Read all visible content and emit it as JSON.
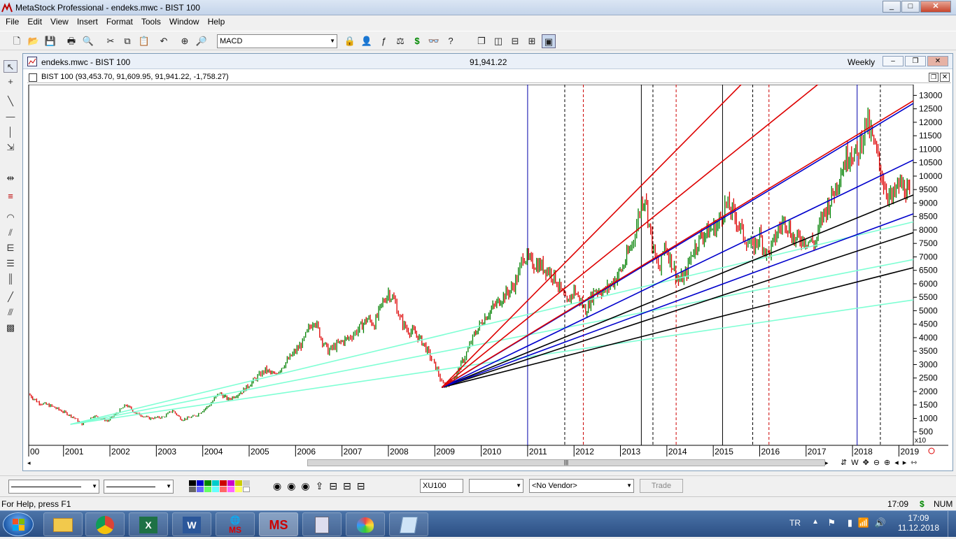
{
  "app": {
    "title": "MetaStock Professional - endeks.mwc - BIST 100",
    "window_buttons": [
      "_",
      "□",
      "✕"
    ]
  },
  "menu": [
    "File",
    "Edit",
    "View",
    "Insert",
    "Format",
    "Tools",
    "Window",
    "Help"
  ],
  "toolbar": {
    "indicator_select": "MACD",
    "icons": [
      "new-icon",
      "open-icon",
      "save-icon",
      "print-icon",
      "print-preview-icon",
      "cut-icon",
      "copy-icon",
      "paste-icon",
      "undo-icon",
      "crosshair-icon",
      "zoom-icon",
      "indicator-builder-icon",
      "expert-advisor-icon",
      "function-icon",
      "system-tester-icon",
      "dollar-icon",
      "explorer-icon",
      "help-icon",
      "cascade-icon",
      "tile-vertical-icon",
      "tile-horizontal-icon",
      "tile-icon",
      "active-icon"
    ]
  },
  "chart_window": {
    "title": "endeks.mwc - BIST 100",
    "price": "91,941.22",
    "periodicity": "Weekly",
    "legend_symbol": "BIST 100",
    "legend_values": "(93,453.70, 91,609.95, 91,941.22, -1,758.27)",
    "scale_label": "x10"
  },
  "chart_data": {
    "type": "candlestick",
    "xlabel": "",
    "ylabel": "",
    "x_ticks": [
      "00",
      "2001",
      "2002",
      "2003",
      "2004",
      "2005",
      "2006",
      "2007",
      "2008",
      "2009",
      "2010",
      "2011",
      "2012",
      "2013",
      "2014",
      "2015",
      "2016",
      "2017",
      "2018",
      "2019"
    ],
    "y_ticks": [
      "13000",
      "12500",
      "12000",
      "11500",
      "11000",
      "10500",
      "10000",
      "9500",
      "9000",
      "8500",
      "8000",
      "7500",
      "7000",
      "6500",
      "6000",
      "5500",
      "5000",
      "4500",
      "4000",
      "3500",
      "3000",
      "2500",
      "2000",
      "1500",
      "1000",
      "500"
    ],
    "ylim": [
      0,
      13400
    ],
    "xlim": [
      2000.0,
      2019.06
    ],
    "price_path": [
      [
        2000.0,
        1900
      ],
      [
        2000.2,
        1600
      ],
      [
        2000.5,
        1450
      ],
      [
        2000.8,
        1200
      ],
      [
        2001.0,
        1000
      ],
      [
        2001.15,
        780
      ],
      [
        2001.4,
        1100
      ],
      [
        2001.7,
        900
      ],
      [
        2001.9,
        1200
      ],
      [
        2002.1,
        1500
      ],
      [
        2002.3,
        1200
      ],
      [
        2002.6,
        1000
      ],
      [
        2002.9,
        1050
      ],
      [
        2003.1,
        1300
      ],
      [
        2003.3,
        950
      ],
      [
        2003.6,
        1100
      ],
      [
        2003.9,
        1500
      ],
      [
        2004.1,
        1950
      ],
      [
        2004.3,
        1700
      ],
      [
        2004.6,
        2000
      ],
      [
        2004.9,
        2500
      ],
      [
        2005.1,
        2800
      ],
      [
        2005.3,
        2600
      ],
      [
        2005.6,
        3200
      ],
      [
        2005.9,
        3800
      ],
      [
        2006.0,
        4200
      ],
      [
        2006.15,
        4700
      ],
      [
        2006.3,
        4000
      ],
      [
        2006.45,
        3500
      ],
      [
        2006.7,
        3800
      ],
      [
        2006.9,
        4000
      ],
      [
        2007.1,
        4300
      ],
      [
        2007.3,
        4700
      ],
      [
        2007.45,
        4500
      ],
      [
        2007.6,
        5200
      ],
      [
        2007.75,
        5700
      ],
      [
        2007.9,
        5300
      ],
      [
        2008.0,
        4700
      ],
      [
        2008.15,
        4300
      ],
      [
        2008.3,
        4200
      ],
      [
        2008.5,
        3800
      ],
      [
        2008.65,
        3300
      ],
      [
        2008.8,
        2800
      ],
      [
        2008.9,
        2300
      ],
      [
        2009.0,
        2200
      ],
      [
        2009.2,
        2600
      ],
      [
        2009.4,
        3300
      ],
      [
        2009.6,
        4100
      ],
      [
        2009.8,
        4700
      ],
      [
        2010.0,
        5100
      ],
      [
        2010.2,
        5500
      ],
      [
        2010.4,
        5800
      ],
      [
        2010.55,
        6300
      ],
      [
        2010.65,
        7100
      ],
      [
        2010.8,
        6800
      ],
      [
        2011.0,
        6700
      ],
      [
        2011.2,
        6500
      ],
      [
        2011.35,
        6200
      ],
      [
        2011.5,
        5600
      ],
      [
        2011.6,
        5200
      ],
      [
        2011.75,
        5800
      ],
      [
        2011.9,
        5300
      ],
      [
        2012.0,
        5000
      ],
      [
        2012.2,
        5800
      ],
      [
        2012.4,
        5700
      ],
      [
        2012.6,
        6100
      ],
      [
        2012.8,
        6600
      ],
      [
        2013.0,
        7500
      ],
      [
        2013.1,
        8200
      ],
      [
        2013.2,
        9000
      ],
      [
        2013.28,
        9300
      ],
      [
        2013.4,
        7800
      ],
      [
        2013.5,
        6900
      ],
      [
        2013.6,
        6500
      ],
      [
        2013.7,
        7500
      ],
      [
        2013.85,
        6800
      ],
      [
        2014.0,
        6100
      ],
      [
        2014.15,
        6300
      ],
      [
        2014.3,
        7200
      ],
      [
        2014.5,
        7800
      ],
      [
        2014.7,
        8000
      ],
      [
        2014.85,
        8200
      ],
      [
        2015.0,
        8900
      ],
      [
        2015.1,
        8800
      ],
      [
        2015.25,
        8400
      ],
      [
        2015.4,
        7800
      ],
      [
        2015.6,
        7300
      ],
      [
        2015.75,
        7800
      ],
      [
        2015.9,
        7100
      ],
      [
        2016.0,
        7300
      ],
      [
        2016.15,
        8000
      ],
      [
        2016.3,
        8400
      ],
      [
        2016.5,
        7600
      ],
      [
        2016.65,
        7700
      ],
      [
        2016.8,
        7600
      ],
      [
        2016.95,
        7500
      ],
      [
        2017.1,
        8500
      ],
      [
        2017.3,
        9200
      ],
      [
        2017.5,
        10200
      ],
      [
        2017.7,
        11000
      ],
      [
        2017.85,
        10700
      ],
      [
        2017.95,
        11500
      ],
      [
        2018.05,
        12000
      ],
      [
        2018.15,
        11500
      ],
      [
        2018.3,
        10600
      ],
      [
        2018.45,
        9600
      ],
      [
        2018.6,
        9100
      ],
      [
        2018.75,
        9700
      ],
      [
        2018.9,
        9500
      ],
      [
        2018.98,
        9200
      ]
    ],
    "vertical_lines": [
      {
        "x": 2010.75,
        "color": "#0000aa",
        "style": "solid"
      },
      {
        "x": 2011.55,
        "color": "#000000",
        "style": "dashed"
      },
      {
        "x": 2011.95,
        "color": "#cc0000",
        "style": "dashed"
      },
      {
        "x": 2013.2,
        "color": "#000000",
        "style": "solid"
      },
      {
        "x": 2013.45,
        "color": "#000000",
        "style": "dashed"
      },
      {
        "x": 2013.95,
        "color": "#cc0000",
        "style": "dashed"
      },
      {
        "x": 2014.95,
        "color": "#000000",
        "style": "solid"
      },
      {
        "x": 2015.6,
        "color": "#000000",
        "style": "dashed"
      },
      {
        "x": 2015.95,
        "color": "#cc0000",
        "style": "dashed"
      },
      {
        "x": 2017.85,
        "color": "#0000aa",
        "style": "solid"
      },
      {
        "x": 2018.35,
        "color": "#000000",
        "style": "dashed"
      }
    ],
    "fan_lines": [
      {
        "from": [
          2000.9,
          780
        ],
        "to": [
          2019.06,
          5400
        ],
        "color": "#7fffd4"
      },
      {
        "from": [
          2000.9,
          780
        ],
        "to": [
          2019.06,
          6900
        ],
        "color": "#7fffd4"
      },
      {
        "from": [
          2000.9,
          780
        ],
        "to": [
          2019.06,
          8300
        ],
        "color": "#7fffd4"
      },
      {
        "from": [
          2008.9,
          2150
        ],
        "to": [
          2019.06,
          6600
        ],
        "color": "#000000"
      },
      {
        "from": [
          2008.9,
          2150
        ],
        "to": [
          2019.06,
          7900
        ],
        "color": "#000000"
      },
      {
        "from": [
          2008.9,
          2150
        ],
        "to": [
          2019.06,
          9300
        ],
        "color": "#000000"
      },
      {
        "from": [
          2008.9,
          2150
        ],
        "to": [
          2019.06,
          8600
        ],
        "color": "#0000cc"
      },
      {
        "from": [
          2008.9,
          2150
        ],
        "to": [
          2019.06,
          10600
        ],
        "color": "#0000cc"
      },
      {
        "from": [
          2008.9,
          2150
        ],
        "to": [
          2019.06,
          12700
        ],
        "color": "#0000cc"
      },
      {
        "from": [
          2008.9,
          2150
        ],
        "to": [
          2019.06,
          12800
        ],
        "color": "#dd0000"
      },
      {
        "from": [
          2008.9,
          2150
        ],
        "to": [
          2017.0,
          13400
        ],
        "color": "#dd0000"
      },
      {
        "from": [
          2008.9,
          2150
        ],
        "to": [
          2015.35,
          13400
        ],
        "color": "#dd0000"
      }
    ]
  },
  "bottom_toolbar": {
    "symbol_field": "XU100",
    "vendor_select": "<No Vendor>",
    "trade_button": "Trade"
  },
  "status": {
    "help_text": "For Help, press F1",
    "time": "17:09",
    "currency": "$",
    "num": "NUM"
  },
  "taskbar": {
    "language": "TR",
    "clock_time": "17:09",
    "clock_date": "11.12.2018",
    "app_label": "MS"
  }
}
